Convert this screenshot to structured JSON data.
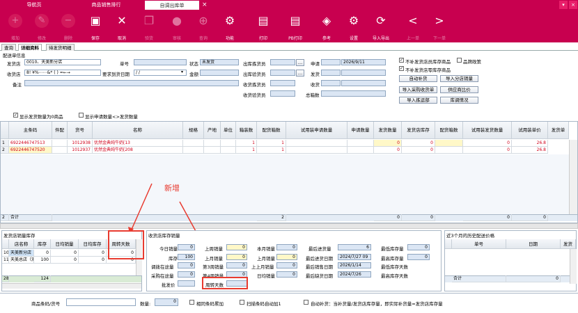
{
  "tabs": [
    {
      "label": "导航页"
    },
    {
      "label": "商品销售排行"
    },
    {
      "label": "自调出库单"
    }
  ],
  "tab_close": "×",
  "toolbar": [
    {
      "label": "增加",
      "icon": "+",
      "enabled": false
    },
    {
      "label": "修改",
      "icon": "✎",
      "enabled": false
    },
    {
      "label": "删除",
      "icon": "−",
      "enabled": false
    },
    {
      "label": "保存",
      "icon": "💾",
      "enabled": true
    },
    {
      "label": "取消",
      "icon": "✕",
      "enabled": true
    },
    {
      "label": "验货",
      "icon": "❐",
      "enabled": false
    },
    {
      "label": "审核",
      "icon": "👤",
      "enabled": false
    },
    {
      "label": "查询",
      "icon": "⊕",
      "enabled": false
    },
    {
      "label": "功能",
      "icon": "⚙",
      "enabled": true
    },
    {
      "label": "打印",
      "icon": "🖶",
      "enabled": true
    },
    {
      "label": "PB打印",
      "icon": "🖶",
      "enabled": true
    },
    {
      "label": "参考",
      "icon": "◈",
      "enabled": true
    },
    {
      "label": "设置",
      "icon": "⚙",
      "enabled": true
    },
    {
      "label": "导入导出",
      "icon": "⟳",
      "enabled": true
    },
    {
      "label": "上一单",
      "icon": "<",
      "enabled": false
    },
    {
      "label": "下一单",
      "icon": ">",
      "enabled": false
    }
  ],
  "subtabs": [
    {
      "label": "查询"
    },
    {
      "label": "详细资料"
    },
    {
      "label": "待发货明细"
    }
  ],
  "form": {
    "section": "配送单信息",
    "ship_store_label": "发货店",
    "ship_store_value": "0010、天美新分店",
    "recv_store_label": "收货店",
    "recv_store_value": "8! ¥%⋯⋯&* ( ) =←→",
    "require_date_label": "要求到货日期",
    "require_date_value": "  /  /",
    "remark_label": "备注",
    "no_label": "单号",
    "amount_label": "金额",
    "status_label": "状态",
    "status_value": "未发货",
    "out_picker_label": "出库拣货员",
    "out_checker_label": "出库验货员",
    "recv_picker_label": "收货拣货员",
    "recv_checker_label": "收货验货员",
    "apply_label": "申请",
    "apply_value": "2026/9/11",
    "ship_label": "发货",
    "recv_label": "收货",
    "total_boxes_label": "总箱数",
    "opt1": "不补发货店员库存商品",
    "opt2": "不补发货店零库存商品",
    "opt3": "品牌政策",
    "btn_auto": "自动补货",
    "btn_import_store_sales": "导入分店销量",
    "btn_import_purchase": "导入采购收货单",
    "btn_supplier_compare": "供应商比价",
    "btn_import_picking": "导入拣运部",
    "btn_inventory": "库调情况",
    "chk_show_zero": "显示发货数量为0商品",
    "chk_show_diff": "显示申请数量<>发货数量"
  },
  "grid": {
    "headers": [
      "主条码",
      "件配",
      "货号",
      "名称",
      "规格",
      "产地",
      "单位",
      "箱装数",
      "配货箱数",
      "试用装申请数量",
      "申请数量",
      "发货数量",
      "发货店库存",
      "配货箱数",
      "试用装发货数量",
      "试用装单价",
      "发货单"
    ],
    "rows": [
      {
        "idx": "1",
        "barcode": "6922446747513",
        "code": "1012938",
        "name": "优然金典纯牛奶[13",
        "box": "1",
        "ship_box": "1",
        "apply_qty": "",
        "ship_qty": "0",
        "stock": "0",
        "trial_ship": "0",
        "price": "26.8"
      },
      {
        "idx": "2",
        "barcode": "6922446747520",
        "code": "1012937",
        "name": "优然金典纯牛奶[208",
        "box": "1",
        "ship_box": "1",
        "apply_qty": "",
        "ship_qty": "0",
        "stock": "0",
        "trial_ship": "0",
        "price": "26.8"
      }
    ],
    "sum_idx": "2",
    "sum_label": "合计",
    "sum_box": "2",
    "sum_vals": [
      "0",
      "0",
      "0",
      "0"
    ]
  },
  "annotation": "新增",
  "stores_panel": {
    "title": "发货店销量库存",
    "headers": [
      "店名称",
      "库存",
      "日均销量",
      "日均库存",
      "周转天数"
    ],
    "rows": [
      {
        "idx": "10",
        "name": "天美新分店",
        "stock": "0",
        "avg_sales": "0",
        "avg_stock": "0",
        "turn": "0"
      },
      {
        "idx": "11",
        "name": "天美总店（测",
        "stock": "100",
        "avg_sales": "0",
        "avg_stock": "0",
        "turn": "0"
      }
    ],
    "sum_idx": "28",
    "sum_value": "124"
  },
  "recv_panel": {
    "title": "收货店库存销量",
    "today_sales": "今日销量",
    "stock": "库存",
    "transfer_out": "调拨在途量",
    "purchase_transit": "采购在途量",
    "wholesale": "批发价",
    "today_val": "0",
    "stock_val": "100",
    "transfer_val": "0",
    "purchase_val": "0",
    "week_sales": "上周销量",
    "last_month": "上月销量",
    "w3": "第3周销量",
    "w4": "第4周销量",
    "turn_days": "周转天数",
    "ws_val": "0",
    "lm_val": "0",
    "w3_val": "0",
    "w4_val": "0",
    "this_month": "本月销量",
    "this_month_val": "0",
    "last_month2": "上月销量",
    "last_month2_val": "0",
    "last_last_month": "上上月销量",
    "last_last_val": "0",
    "daily_avg": "日均销量",
    "daily_avg_val": "0",
    "latest_ship": "最后进货量",
    "latest_ship_val": "6",
    "latest_in_date": "最后进货日期",
    "latest_in_date_val": "2024/7/27 09",
    "latest_sale_date": "最后销售日期",
    "latest_sale_date_val": "2026/1/14",
    "latest_stock_date": "最后缺货日期",
    "latest_stock_date_val": "2024/7/26",
    "min_stock": "最低库存量",
    "max_stock": "最高库存量",
    "min_days": "最低库存天数",
    "max_days": "最高库存天数",
    "min_val": "0",
    "max_val": "0"
  },
  "history_panel": {
    "title": "近3个月的历史配送价格",
    "headers": [
      "单号",
      "日期",
      "发货"
    ],
    "sum_label": "合计",
    "sum_value": "0"
  },
  "bottom": {
    "barcode_label": "商品条码/货号",
    "qty_label": "数量:",
    "qty_value": "0",
    "chk1": "相同条码累加",
    "chk2": "扫描条码自动加1",
    "chk3": "自动补货：当补货量/发货店库存量，即实际补货量=发货店库存量"
  }
}
